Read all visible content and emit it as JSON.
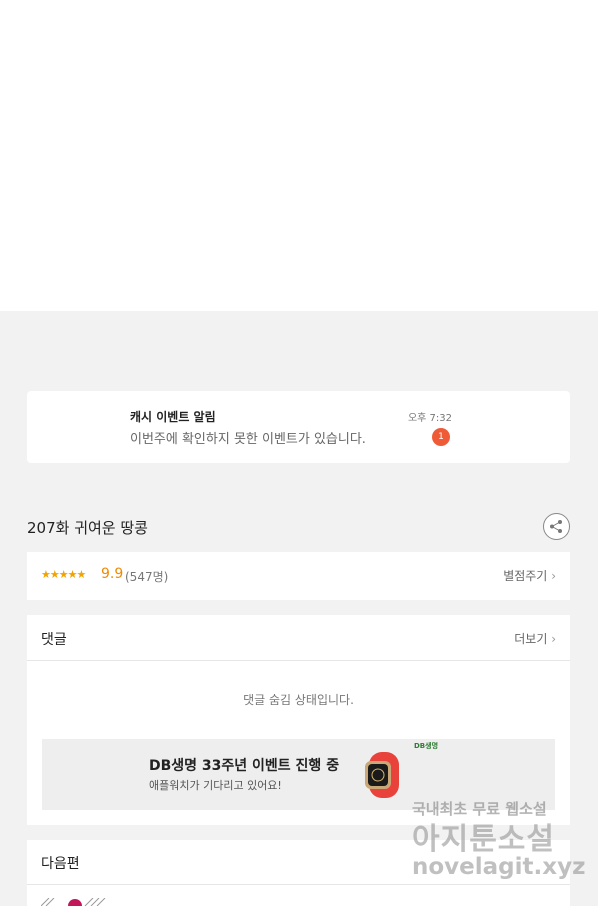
{
  "notification": {
    "title": "캐시 이벤트 알림",
    "body": "이번주에 확인하지 못한 이벤트가 있습니다.",
    "time": "오후 7:32",
    "badge_count": "1"
  },
  "episode": {
    "title": "207화 귀여운 땅콩",
    "share_icon": "share-icon"
  },
  "rating": {
    "stars": "★★★★★",
    "score": "9.9",
    "count": "(547명)",
    "rate_label": "별점주기",
    "rate_chevron": "›"
  },
  "comments": {
    "label": "댓글",
    "more_label": "더보기",
    "more_chevron": "›",
    "hidden_message": "댓글 숨김 상태입니다."
  },
  "ad": {
    "title": "DB생명 33주년 이벤트 진행 중",
    "subtitle": "애플워치가 기다리고 있어요!",
    "logo": "DB생명"
  },
  "next": {
    "label": "다음편"
  },
  "watermark": {
    "line1a": "국내최초 무료",
    "line1b": "웹소설",
    "line2": "아지툰소설",
    "line3": "novelagit.xyz"
  },
  "colors": {
    "badge": "#ef5b36",
    "star": "#f2a300",
    "score": "#f08a00",
    "background": "#f2f2f2"
  }
}
